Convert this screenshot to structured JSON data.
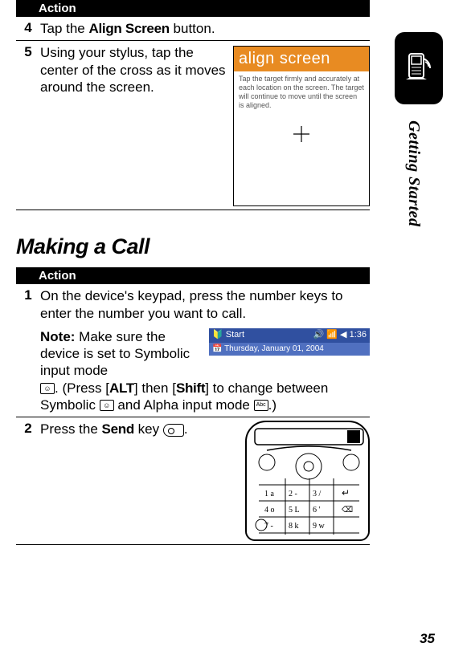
{
  "side": {
    "label": "Getting Started"
  },
  "table1": {
    "header": "Action",
    "rows": {
      "r4": {
        "num": "4",
        "prefix": "Tap the ",
        "bold": "Align Screen",
        "suffix": " button."
      },
      "r5": {
        "num": "5",
        "text": "Using your stylus, tap the center of the cross as it moves around the screen."
      }
    },
    "preview": {
      "title": "align screen",
      "small": "Tap the target firmly and accurately at each location on the screen. The target will continue to move until the screen is aligned."
    }
  },
  "section_heading": "Making a Call",
  "table2": {
    "header": "Action",
    "rows": {
      "r1": {
        "num": "1",
        "line1": "On the device's keypad, press the number keys to enter the number you want to call.",
        "note_label": "Note:",
        "note_1": " Make sure the device is set to Symbolic input mode ",
        "note_2": ". (Press ",
        "alt": "ALT",
        "note_3": " then ",
        "shift": "Shift",
        "note_4": " to change between Symbolic ",
        "note_5": " and Alpha input mode ",
        "note_6": ".)",
        "startbar": {
          "left": "Start",
          "right": "1:36",
          "date": "Thursday, January 01, 2004"
        }
      },
      "r2": {
        "num": "2",
        "prefix": "Press the ",
        "bold": "Send",
        "suffix": " key ",
        "tail": "."
      }
    }
  },
  "page_number": "35"
}
